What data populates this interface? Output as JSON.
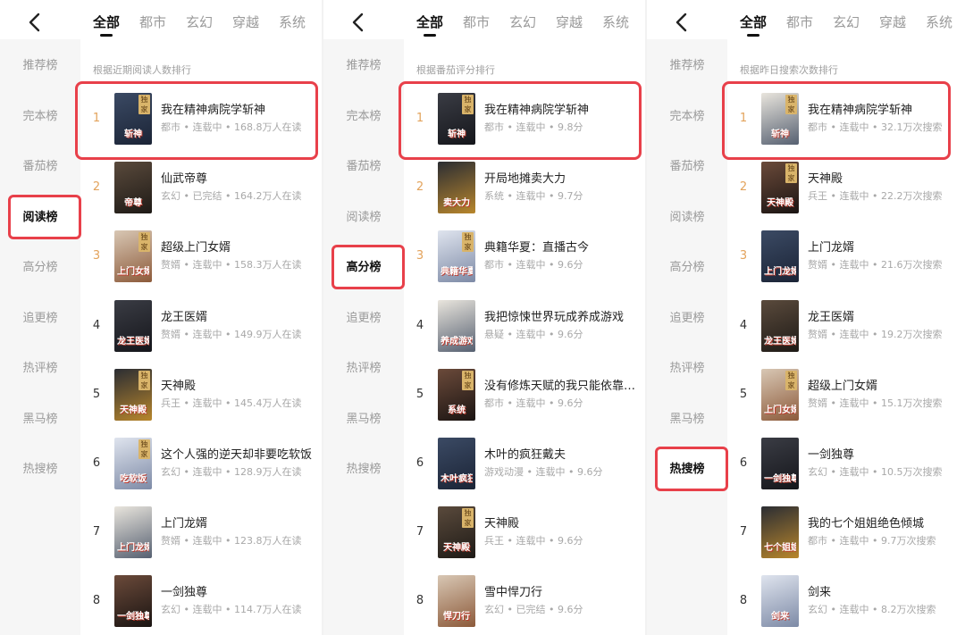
{
  "tabs": [
    "全部",
    "都市",
    "玄幻",
    "穿越",
    "系统"
  ],
  "sidebar": [
    "推荐榜",
    "完本榜",
    "番茄榜",
    "阅读榜",
    "高分榜",
    "追更榜",
    "热评榜",
    "黑马榜",
    "热搜榜"
  ],
  "panels": [
    {
      "active_sidebar": 3,
      "subtitle": "根据近期阅读人数排行",
      "books": [
        {
          "rank": "1",
          "title": "我在精神病院学斩神",
          "meta": "都市 • 连载中 • 168.8万人在读",
          "cover": "斩神",
          "exclusive": true
        },
        {
          "rank": "2",
          "title": "仙武帝尊",
          "meta": "玄幻 • 已完结 • 164.2万人在读",
          "cover": "帝尊",
          "exclusive": false
        },
        {
          "rank": "3",
          "title": "超级上门女婿",
          "meta": "赘婿 • 连载中 • 158.3万人在读",
          "cover": "上门女婿",
          "exclusive": true
        },
        {
          "rank": "4",
          "title": "龙王医婿",
          "meta": "赘婿 • 连载中 • 149.9万人在读",
          "cover": "龙王医婿",
          "exclusive": false
        },
        {
          "rank": "5",
          "title": "天神殿",
          "meta": "兵王 • 连载中 • 145.4万人在读",
          "cover": "天神殿",
          "exclusive": true
        },
        {
          "rank": "6",
          "title": "这个人强的逆天却非要吃软饭",
          "meta": "玄幻 • 连载中 • 128.9万人在读",
          "cover": "吃软饭",
          "exclusive": true
        },
        {
          "rank": "7",
          "title": "上门龙婿",
          "meta": "赘婿 • 连载中 • 123.8万人在读",
          "cover": "上门龙婿",
          "exclusive": false
        },
        {
          "rank": "8",
          "title": "一剑独尊",
          "meta": "玄幻 • 连载中 • 114.7万人在读",
          "cover": "一剑独尊",
          "exclusive": false
        }
      ]
    },
    {
      "active_sidebar": 4,
      "subtitle": "根据番茄评分排行",
      "books": [
        {
          "rank": "1",
          "title": "我在精神病院学斩神",
          "meta": "都市 • 连载中 • 9.8分",
          "cover": "斩神",
          "exclusive": true
        },
        {
          "rank": "2",
          "title": "开局地摊卖大力",
          "meta": "系统 • 连载中 • 9.7分",
          "cover": "卖大力",
          "exclusive": false
        },
        {
          "rank": "3",
          "title": "典籍华夏：直播古今",
          "meta": "都市 • 连载中 • 9.6分",
          "cover": "典籍华夏",
          "exclusive": true
        },
        {
          "rank": "4",
          "title": "我把惊悚世界玩成养成游戏",
          "meta": "悬疑 • 连载中 • 9.6分",
          "cover": "养成游戏",
          "exclusive": false
        },
        {
          "rank": "5",
          "title": "没有修炼天赋的我只能依靠系统",
          "meta": "都市 • 连载中 • 9.6分",
          "cover": "系统",
          "exclusive": true
        },
        {
          "rank": "6",
          "title": "木叶的疯狂戴夫",
          "meta": "游戏动漫 • 连载中 • 9.6分",
          "cover": "木叶疯狂",
          "exclusive": false
        },
        {
          "rank": "7",
          "title": "天神殿",
          "meta": "兵王 • 连载中 • 9.6分",
          "cover": "天神殿",
          "exclusive": true
        },
        {
          "rank": "8",
          "title": "雪中悍刀行",
          "meta": "玄幻 • 已完结 • 9.6分",
          "cover": "悍刀行",
          "exclusive": false
        }
      ]
    },
    {
      "active_sidebar": 8,
      "subtitle": "根据昨日搜索次数排行",
      "books": [
        {
          "rank": "1",
          "title": "我在精神病院学斩神",
          "meta": "都市 • 连载中 • 32.1万次搜索",
          "cover": "斩神",
          "exclusive": true
        },
        {
          "rank": "2",
          "title": "天神殿",
          "meta": "兵王 • 连载中 • 22.2万次搜索",
          "cover": "天神殿",
          "exclusive": true
        },
        {
          "rank": "3",
          "title": "上门龙婿",
          "meta": "赘婿 • 连载中 • 21.6万次搜索",
          "cover": "上门龙婿",
          "exclusive": false
        },
        {
          "rank": "4",
          "title": "龙王医婿",
          "meta": "赘婿 • 连载中 • 19.2万次搜索",
          "cover": "龙王医婿",
          "exclusive": false
        },
        {
          "rank": "5",
          "title": "超级上门女婿",
          "meta": "赘婿 • 连载中 • 15.1万次搜索",
          "cover": "上门女婿",
          "exclusive": true
        },
        {
          "rank": "6",
          "title": "一剑独尊",
          "meta": "玄幻 • 连载中 • 10.5万次搜索",
          "cover": "一剑独尊",
          "exclusive": false
        },
        {
          "rank": "7",
          "title": "我的七个姐姐绝色倾城",
          "meta": "都市 • 连载中 • 9.7万次搜索",
          "cover": "七个姐姐",
          "exclusive": false
        },
        {
          "rank": "8",
          "title": "剑来",
          "meta": "玄幻 • 连载中 • 8.2万次搜索",
          "cover": "剑来",
          "exclusive": false
        }
      ]
    }
  ],
  "exclusive_label": "独家",
  "colors": {
    "highlight": "#e8404a",
    "rank_top": "#e3a35c",
    "sidebar_bg": "#f6f6f6"
  },
  "icons": {
    "back": "chevron-left-icon",
    "cover": "book-cover"
  }
}
